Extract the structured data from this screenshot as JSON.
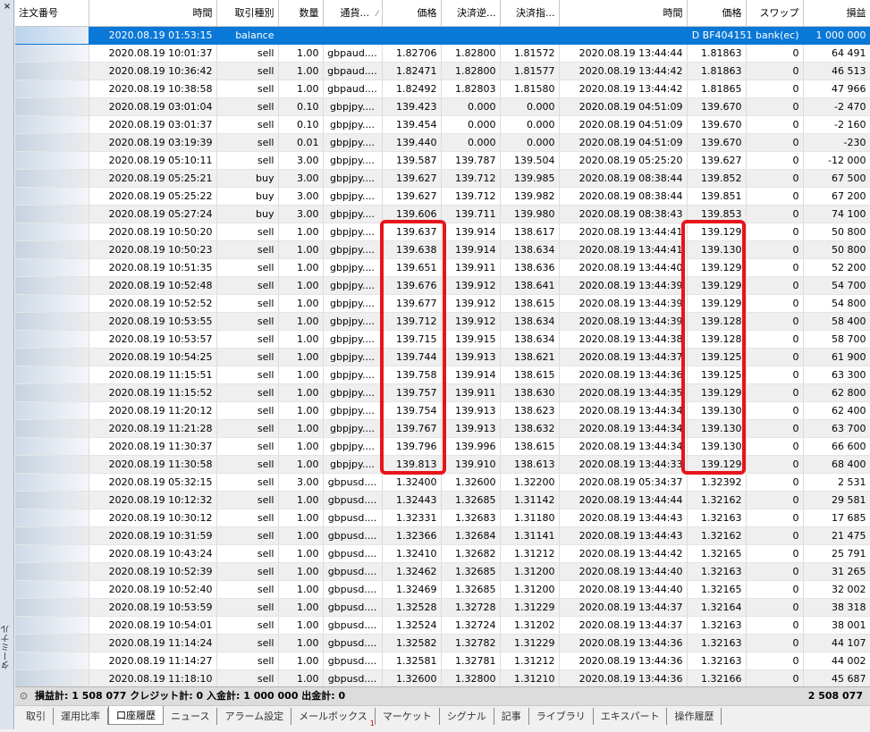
{
  "sidebar": {
    "close_glyph": "×",
    "label": "ターミナル"
  },
  "columns": [
    "注文番号",
    "時間",
    "取引種別",
    "数量",
    "通貨...",
    "価格",
    "決済逆...",
    "決済指...",
    "時間",
    "価格",
    "スワップ",
    "損益"
  ],
  "sort_arrow": "⁄",
  "rows": [
    {
      "t1": "2020.08.19 01:53:15",
      "type": "balance",
      "comment": "D BF404151 bank(ec)",
      "pl": "1 000 000"
    },
    {
      "t1": "2020.08.19 10:01:37",
      "type": "sell",
      "vol": "1.00",
      "sym": "gbpaud....",
      "p1": "1.82706",
      "sl": "1.82800",
      "tp": "1.81572",
      "t2": "2020.08.19 13:44:44",
      "p2": "1.81863",
      "swap": "0",
      "pl": "64 491"
    },
    {
      "t1": "2020.08.19 10:36:42",
      "type": "sell",
      "vol": "1.00",
      "sym": "gbpaud....",
      "p1": "1.82471",
      "sl": "1.82800",
      "tp": "1.81577",
      "t2": "2020.08.19 13:44:42",
      "p2": "1.81863",
      "swap": "0",
      "pl": "46 513"
    },
    {
      "t1": "2020.08.19 10:38:58",
      "type": "sell",
      "vol": "1.00",
      "sym": "gbpaud....",
      "p1": "1.82492",
      "sl": "1.82803",
      "tp": "1.81580",
      "t2": "2020.08.19 13:44:42",
      "p2": "1.81865",
      "swap": "0",
      "pl": "47 966"
    },
    {
      "t1": "2020.08.19 03:01:04",
      "type": "sell",
      "vol": "0.10",
      "sym": "gbpjpy....",
      "p1": "139.423",
      "sl": "0.000",
      "tp": "0.000",
      "t2": "2020.08.19 04:51:09",
      "p2": "139.670",
      "swap": "0",
      "pl": "-2 470"
    },
    {
      "t1": "2020.08.19 03:01:37",
      "type": "sell",
      "vol": "0.10",
      "sym": "gbpjpy....",
      "p1": "139.454",
      "sl": "0.000",
      "tp": "0.000",
      "t2": "2020.08.19 04:51:09",
      "p2": "139.670",
      "swap": "0",
      "pl": "-2 160"
    },
    {
      "t1": "2020.08.19 03:19:39",
      "type": "sell",
      "vol": "0.01",
      "sym": "gbpjpy....",
      "p1": "139.440",
      "sl": "0.000",
      "tp": "0.000",
      "t2": "2020.08.19 04:51:09",
      "p2": "139.670",
      "swap": "0",
      "pl": "-230"
    },
    {
      "t1": "2020.08.19 05:10:11",
      "type": "sell",
      "vol": "3.00",
      "sym": "gbpjpy....",
      "p1": "139.587",
      "sl": "139.787",
      "tp": "139.504",
      "t2": "2020.08.19 05:25:20",
      "p2": "139.627",
      "swap": "0",
      "pl": "-12 000"
    },
    {
      "t1": "2020.08.19 05:25:21",
      "type": "buy",
      "vol": "3.00",
      "sym": "gbpjpy....",
      "p1": "139.627",
      "sl": "139.712",
      "tp": "139.985",
      "t2": "2020.08.19 08:38:44",
      "p2": "139.852",
      "swap": "0",
      "pl": "67 500"
    },
    {
      "t1": "2020.08.19 05:25:22",
      "type": "buy",
      "vol": "3.00",
      "sym": "gbpjpy....",
      "p1": "139.627",
      "sl": "139.712",
      "tp": "139.982",
      "t2": "2020.08.19 08:38:44",
      "p2": "139.851",
      "swap": "0",
      "pl": "67 200"
    },
    {
      "t1": "2020.08.19 05:27:24",
      "type": "buy",
      "vol": "3.00",
      "sym": "gbpjpy....",
      "p1": "139.606",
      "sl": "139.711",
      "tp": "139.980",
      "t2": "2020.08.19 08:38:43",
      "p2": "139.853",
      "swap": "0",
      "pl": "74 100"
    },
    {
      "t1": "2020.08.19 10:50:20",
      "type": "sell",
      "vol": "1.00",
      "sym": "gbpjpy....",
      "p1": "139.637",
      "sl": "139.914",
      "tp": "138.617",
      "t2": "2020.08.19 13:44:41",
      "p2": "139.129",
      "swap": "0",
      "pl": "50 800"
    },
    {
      "t1": "2020.08.19 10:50:23",
      "type": "sell",
      "vol": "1.00",
      "sym": "gbpjpy....",
      "p1": "139.638",
      "sl": "139.914",
      "tp": "138.634",
      "t2": "2020.08.19 13:44:41",
      "p2": "139.130",
      "swap": "0",
      "pl": "50 800"
    },
    {
      "t1": "2020.08.19 10:51:35",
      "type": "sell",
      "vol": "1.00",
      "sym": "gbpjpy....",
      "p1": "139.651",
      "sl": "139.911",
      "tp": "138.636",
      "t2": "2020.08.19 13:44:40",
      "p2": "139.129",
      "swap": "0",
      "pl": "52 200"
    },
    {
      "t1": "2020.08.19 10:52:48",
      "type": "sell",
      "vol": "1.00",
      "sym": "gbpjpy....",
      "p1": "139.676",
      "sl": "139.912",
      "tp": "138.641",
      "t2": "2020.08.19 13:44:39",
      "p2": "139.129",
      "swap": "0",
      "pl": "54 700"
    },
    {
      "t1": "2020.08.19 10:52:52",
      "type": "sell",
      "vol": "1.00",
      "sym": "gbpjpy....",
      "p1": "139.677",
      "sl": "139.912",
      "tp": "138.615",
      "t2": "2020.08.19 13:44:39",
      "p2": "139.129",
      "swap": "0",
      "pl": "54 800"
    },
    {
      "t1": "2020.08.19 10:53:55",
      "type": "sell",
      "vol": "1.00",
      "sym": "gbpjpy....",
      "p1": "139.712",
      "sl": "139.912",
      "tp": "138.634",
      "t2": "2020.08.19 13:44:39",
      "p2": "139.128",
      "swap": "0",
      "pl": "58 400"
    },
    {
      "t1": "2020.08.19 10:53:57",
      "type": "sell",
      "vol": "1.00",
      "sym": "gbpjpy....",
      "p1": "139.715",
      "sl": "139.915",
      "tp": "138.634",
      "t2": "2020.08.19 13:44:38",
      "p2": "139.128",
      "swap": "0",
      "pl": "58 700"
    },
    {
      "t1": "2020.08.19 10:54:25",
      "type": "sell",
      "vol": "1.00",
      "sym": "gbpjpy....",
      "p1": "139.744",
      "sl": "139.913",
      "tp": "138.621",
      "t2": "2020.08.19 13:44:37",
      "p2": "139.125",
      "swap": "0",
      "pl": "61 900"
    },
    {
      "t1": "2020.08.19 11:15:51",
      "type": "sell",
      "vol": "1.00",
      "sym": "gbpjpy....",
      "p1": "139.758",
      "sl": "139.914",
      "tp": "138.615",
      "t2": "2020.08.19 13:44:36",
      "p2": "139.125",
      "swap": "0",
      "pl": "63 300"
    },
    {
      "t1": "2020.08.19 11:15:52",
      "type": "sell",
      "vol": "1.00",
      "sym": "gbpjpy....",
      "p1": "139.757",
      "sl": "139.911",
      "tp": "138.630",
      "t2": "2020.08.19 13:44:35",
      "p2": "139.129",
      "swap": "0",
      "pl": "62 800"
    },
    {
      "t1": "2020.08.19 11:20:12",
      "type": "sell",
      "vol": "1.00",
      "sym": "gbpjpy....",
      "p1": "139.754",
      "sl": "139.913",
      "tp": "138.623",
      "t2": "2020.08.19 13:44:34",
      "p2": "139.130",
      "swap": "0",
      "pl": "62 400"
    },
    {
      "t1": "2020.08.19 11:21:28",
      "type": "sell",
      "vol": "1.00",
      "sym": "gbpjpy....",
      "p1": "139.767",
      "sl": "139.913",
      "tp": "138.632",
      "t2": "2020.08.19 13:44:34",
      "p2": "139.130",
      "swap": "0",
      "pl": "63 700"
    },
    {
      "t1": "2020.08.19 11:30:37",
      "type": "sell",
      "vol": "1.00",
      "sym": "gbpjpy....",
      "p1": "139.796",
      "sl": "139.996",
      "tp": "138.615",
      "t2": "2020.08.19 13:44:34",
      "p2": "139.130",
      "swap": "0",
      "pl": "66 600"
    },
    {
      "t1": "2020.08.19 11:30:58",
      "type": "sell",
      "vol": "1.00",
      "sym": "gbpjpy....",
      "p1": "139.813",
      "sl": "139.910",
      "tp": "138.613",
      "t2": "2020.08.19 13:44:33",
      "p2": "139.129",
      "swap": "0",
      "pl": "68 400"
    },
    {
      "t1": "2020.08.19 05:32:15",
      "type": "sell",
      "vol": "3.00",
      "sym": "gbpusd....",
      "p1": "1.32400",
      "sl": "1.32600",
      "tp": "1.32200",
      "t2": "2020.08.19 05:34:37",
      "p2": "1.32392",
      "swap": "0",
      "pl": "2 531"
    },
    {
      "t1": "2020.08.19 10:12:32",
      "type": "sell",
      "vol": "1.00",
      "sym": "gbpusd....",
      "p1": "1.32443",
      "sl": "1.32685",
      "tp": "1.31142",
      "t2": "2020.08.19 13:44:44",
      "p2": "1.32162",
      "swap": "0",
      "pl": "29 581"
    },
    {
      "t1": "2020.08.19 10:30:12",
      "type": "sell",
      "vol": "1.00",
      "sym": "gbpusd....",
      "p1": "1.32331",
      "sl": "1.32683",
      "tp": "1.31180",
      "t2": "2020.08.19 13:44:43",
      "p2": "1.32163",
      "swap": "0",
      "pl": "17 685"
    },
    {
      "t1": "2020.08.19 10:31:59",
      "type": "sell",
      "vol": "1.00",
      "sym": "gbpusd....",
      "p1": "1.32366",
      "sl": "1.32684",
      "tp": "1.31141",
      "t2": "2020.08.19 13:44:43",
      "p2": "1.32162",
      "swap": "0",
      "pl": "21 475"
    },
    {
      "t1": "2020.08.19 10:43:24",
      "type": "sell",
      "vol": "1.00",
      "sym": "gbpusd....",
      "p1": "1.32410",
      "sl": "1.32682",
      "tp": "1.31212",
      "t2": "2020.08.19 13:44:42",
      "p2": "1.32165",
      "swap": "0",
      "pl": "25 791"
    },
    {
      "t1": "2020.08.19 10:52:39",
      "type": "sell",
      "vol": "1.00",
      "sym": "gbpusd....",
      "p1": "1.32462",
      "sl": "1.32685",
      "tp": "1.31200",
      "t2": "2020.08.19 13:44:40",
      "p2": "1.32163",
      "swap": "0",
      "pl": "31 265"
    },
    {
      "t1": "2020.08.19 10:52:40",
      "type": "sell",
      "vol": "1.00",
      "sym": "gbpusd....",
      "p1": "1.32469",
      "sl": "1.32685",
      "tp": "1.31200",
      "t2": "2020.08.19 13:44:40",
      "p2": "1.32165",
      "swap": "0",
      "pl": "32 002"
    },
    {
      "t1": "2020.08.19 10:53:59",
      "type": "sell",
      "vol": "1.00",
      "sym": "gbpusd....",
      "p1": "1.32528",
      "sl": "1.32728",
      "tp": "1.31229",
      "t2": "2020.08.19 13:44:37",
      "p2": "1.32164",
      "swap": "0",
      "pl": "38 318"
    },
    {
      "t1": "2020.08.19 10:54:01",
      "type": "sell",
      "vol": "1.00",
      "sym": "gbpusd....",
      "p1": "1.32524",
      "sl": "1.32724",
      "tp": "1.31202",
      "t2": "2020.08.19 13:44:37",
      "p2": "1.32163",
      "swap": "0",
      "pl": "38 001"
    },
    {
      "t1": "2020.08.19 11:14:24",
      "type": "sell",
      "vol": "1.00",
      "sym": "gbpusd....",
      "p1": "1.32582",
      "sl": "1.32782",
      "tp": "1.31229",
      "t2": "2020.08.19 13:44:36",
      "p2": "1.32163",
      "swap": "0",
      "pl": "44 107"
    },
    {
      "t1": "2020.08.19 11:14:27",
      "type": "sell",
      "vol": "1.00",
      "sym": "gbpusd....",
      "p1": "1.32581",
      "sl": "1.32781",
      "tp": "1.31212",
      "t2": "2020.08.19 13:44:36",
      "p2": "1.32163",
      "swap": "0",
      "pl": "44 002"
    },
    {
      "t1": "2020.08.19 11:18:10",
      "type": "sell",
      "vol": "1.00",
      "sym": "gbpusd....",
      "p1": "1.32600",
      "sl": "1.32800",
      "tp": "1.31210",
      "t2": "2020.08.19 13:44:36",
      "p2": "1.32166",
      "swap": "0",
      "pl": "45 687"
    }
  ],
  "status": {
    "icon": "⊙",
    "summary": "損益計: 1 508 077  クレジット計: 0  入金計: 1 000 000  出金計: 0",
    "total": "2 508 077"
  },
  "tabs": [
    {
      "label": "取引"
    },
    {
      "label": "運用比率"
    },
    {
      "label": "口座履歴",
      "active": true
    },
    {
      "label": "ニュース"
    },
    {
      "label": "アラーム設定"
    },
    {
      "label": "メールボックス",
      "badge": "1"
    },
    {
      "label": "マーケット"
    },
    {
      "label": "シグナル"
    },
    {
      "label": "記事"
    },
    {
      "label": "ライブラリ"
    },
    {
      "label": "エキスパート"
    },
    {
      "label": "操作履歴"
    }
  ],
  "colors": {
    "selected_row": "#0a78d7",
    "highlight_box": "#e8141c",
    "alt_row": "#efefef"
  }
}
